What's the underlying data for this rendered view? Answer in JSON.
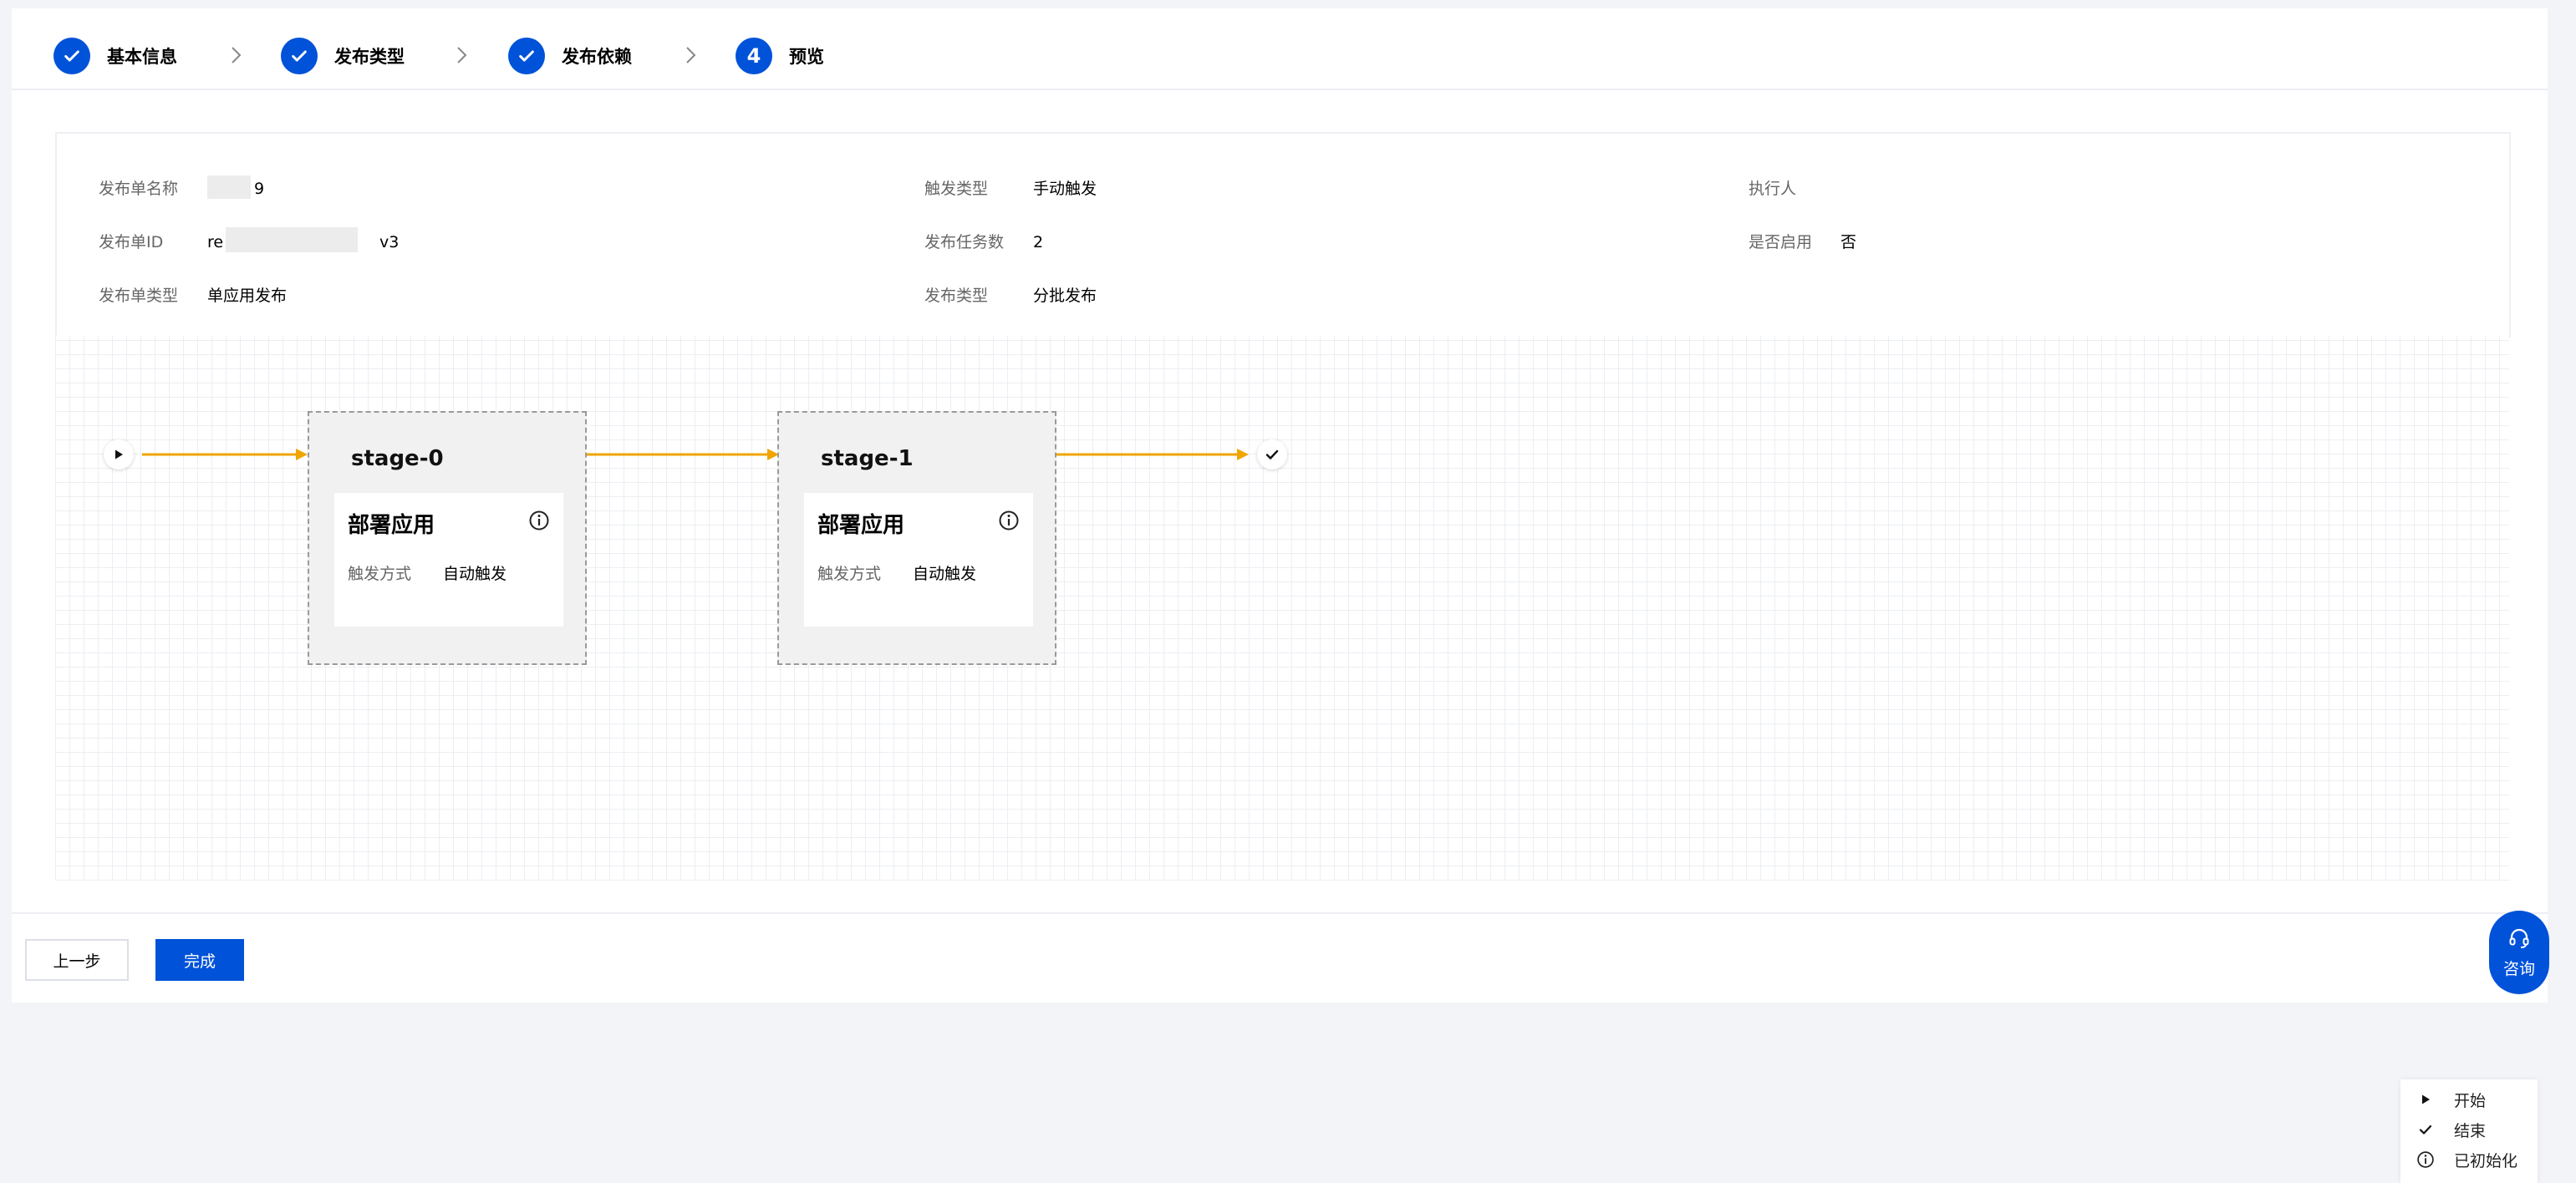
{
  "steps": [
    {
      "label": "基本信息",
      "state": "done"
    },
    {
      "label": "发布类型",
      "state": "done"
    },
    {
      "label": "发布依赖",
      "state": "done"
    },
    {
      "label": "预览",
      "state": "current",
      "number": "4"
    }
  ],
  "info": {
    "name_label": "发布单名称",
    "name_value": "9",
    "id_label": "发布单ID",
    "id_value_prefix": "re",
    "id_value_suffix": "v3",
    "type_label": "发布单类型",
    "type_value": "单应用发布",
    "trigger_type_label": "触发类型",
    "trigger_type_value": "手动触发",
    "task_count_label": "发布任务数",
    "task_count_value": "2",
    "release_type_label": "发布类型",
    "release_type_value": "分批发布",
    "executor_label": "执行人",
    "executor_value": "",
    "enabled_label": "是否启用",
    "enabled_value": "否"
  },
  "stages": [
    {
      "title": "stage-0",
      "task_title": "部署应用",
      "trigger_label": "触发方式",
      "trigger_value": "自动触发"
    },
    {
      "title": "stage-1",
      "task_title": "部署应用",
      "trigger_label": "触发方式",
      "trigger_value": "自动触发"
    }
  ],
  "legend": {
    "start": "开始",
    "end": "结束",
    "initialized": "已初始化"
  },
  "buttons": {
    "prev": "上一步",
    "done": "完成",
    "consult": "咨询"
  },
  "colors": {
    "primary": "#0052d9",
    "connector": "#f0a500"
  }
}
